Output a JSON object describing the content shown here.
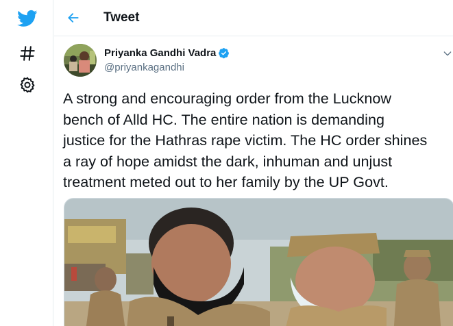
{
  "header": {
    "title": "Tweet"
  },
  "nav": {
    "icons": [
      "twitter-bird-icon",
      "hashtag-icon",
      "settings-gear-icon"
    ]
  },
  "tweet": {
    "author_name": "Priyanka Gandhi Vadra",
    "handle": "@priyankagandhi",
    "verified": true,
    "text": "A strong and encouraging order from the Lucknow\nbench of Alld HC. The entire nation is demanding\njustice for the Hathras rape victim. The HC order shines\na ray of hope amidst the dark, inhuman and unjust\ntreatment meted out to her family by the UP Govt."
  },
  "colors": {
    "accent": "#1da1f2",
    "text": "#0f1419",
    "secondary_text": "#5b7083",
    "border": "#e6ecf0"
  }
}
